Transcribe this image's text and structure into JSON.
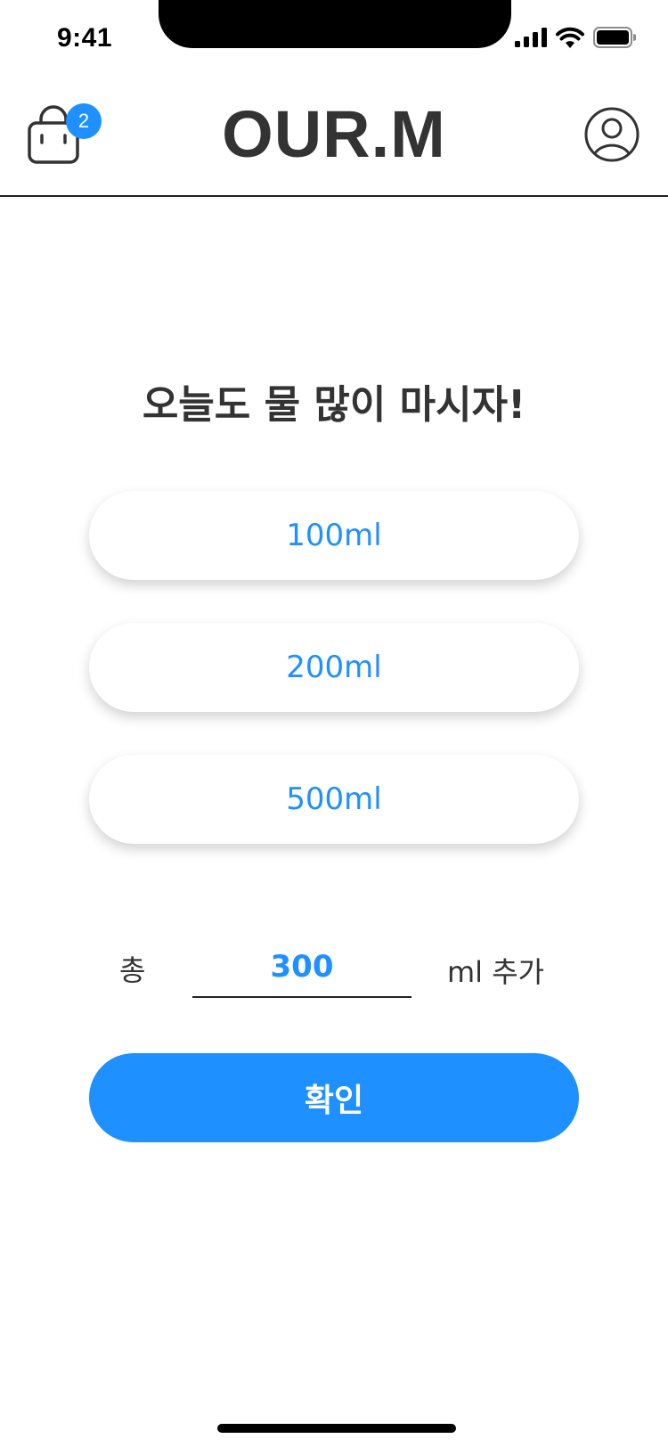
{
  "status_bar": {
    "time": "9:41",
    "icons": [
      "signal-icon",
      "wifi-icon",
      "battery-icon"
    ]
  },
  "header": {
    "title": "OUR.M",
    "cart_badge_count": "2",
    "icons": [
      "shopping-bag-icon",
      "profile-icon"
    ]
  },
  "main": {
    "headline": "오늘도 물 많이 마시자!",
    "amount_options": [
      {
        "label": "100ml"
      },
      {
        "label": "200ml"
      },
      {
        "label": "500ml"
      }
    ],
    "total": {
      "prefix": "총",
      "value": "300",
      "suffix": "ml 추가"
    },
    "confirm_label": "확인"
  },
  "colors": {
    "accent": "#1e90ff",
    "text": "#333333",
    "background": "#ffffff"
  }
}
